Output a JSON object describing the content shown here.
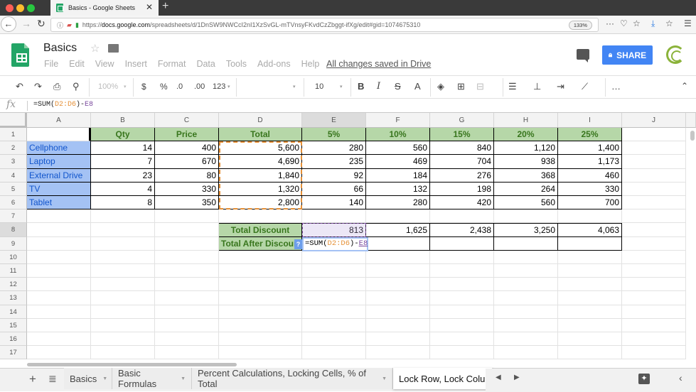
{
  "browser": {
    "tab_title": "Basics - Google Sheets",
    "url_host": "docs.google.com",
    "url_prefix": "https://",
    "url_path": "/spreadsheets/d/1DnSW9NWCcI2nI1XzSvGL-mTVnsyFKvdCzZbggt-ifXg/edit#gid=1074675310",
    "zoom": "133%"
  },
  "app": {
    "doc_title": "Basics",
    "menu": [
      "File",
      "Edit",
      "View",
      "Insert",
      "Format",
      "Data",
      "Tools",
      "Add-ons",
      "Help"
    ],
    "save_status": "All changes saved in Drive",
    "share_label": "SHARE",
    "brand_color": "#4285f4"
  },
  "toolbar": {
    "zoom": "100%",
    "currency": "$",
    "percent": "%",
    "dec_decrease": ".0",
    "dec_increase": ".00",
    "more_formats": "123",
    "font_size": "10",
    "bold": "B",
    "italic": "I",
    "strike": "S",
    "text_color": "A",
    "more": "…"
  },
  "formula_bar": {
    "fx": "fx",
    "prefix": "=SUM(",
    "range": "D2:D6",
    "mid": ")-",
    "ref": "E8"
  },
  "grid": {
    "columns": [
      "A",
      "B",
      "C",
      "D",
      "E",
      "F",
      "G",
      "H",
      "I",
      "J"
    ],
    "rows": [
      "1",
      "2",
      "3",
      "4",
      "5",
      "6",
      "7",
      "8",
      "9",
      "10",
      "11",
      "12",
      "13",
      "14",
      "15",
      "16",
      "17"
    ],
    "header_row": [
      "",
      "Qty",
      "Price",
      "Total",
      "5%",
      "10%",
      "15%",
      "20%",
      "25%"
    ],
    "data_rows": [
      [
        "Cellphone",
        "14",
        "400",
        "5,600",
        "280",
        "560",
        "840",
        "1,120",
        "1,400"
      ],
      [
        "Laptop",
        "7",
        "670",
        "4,690",
        "235",
        "469",
        "704",
        "938",
        "1,173"
      ],
      [
        "External Drive",
        "23",
        "80",
        "1,840",
        "92",
        "184",
        "276",
        "368",
        "460"
      ],
      [
        "TV",
        "4",
        "330",
        "1,320",
        "66",
        "132",
        "198",
        "264",
        "330"
      ],
      [
        "Tablet",
        "8",
        "350",
        "2,800",
        "140",
        "280",
        "420",
        "560",
        "700"
      ]
    ],
    "total_discount_label": "Total Discount",
    "total_discount_values": [
      "813",
      "1,625",
      "2,438",
      "3,250",
      "4,063"
    ],
    "total_after_label": "Total After Discount",
    "editing_formula_prefix": "=SUM(",
    "editing_formula_range": "D2:D6",
    "editing_formula_mid": ")-",
    "editing_formula_ref": "E8",
    "help_badge": "?",
    "header_fill": "#b6d7a8",
    "label_fill": "#a4c2f4"
  },
  "sheets": {
    "tabs": [
      "Basics",
      "Basic Formulas",
      "Percent Calculations, Locking Cells, % of Total",
      "Lock Row, Lock Colum"
    ],
    "active_index": 3
  }
}
